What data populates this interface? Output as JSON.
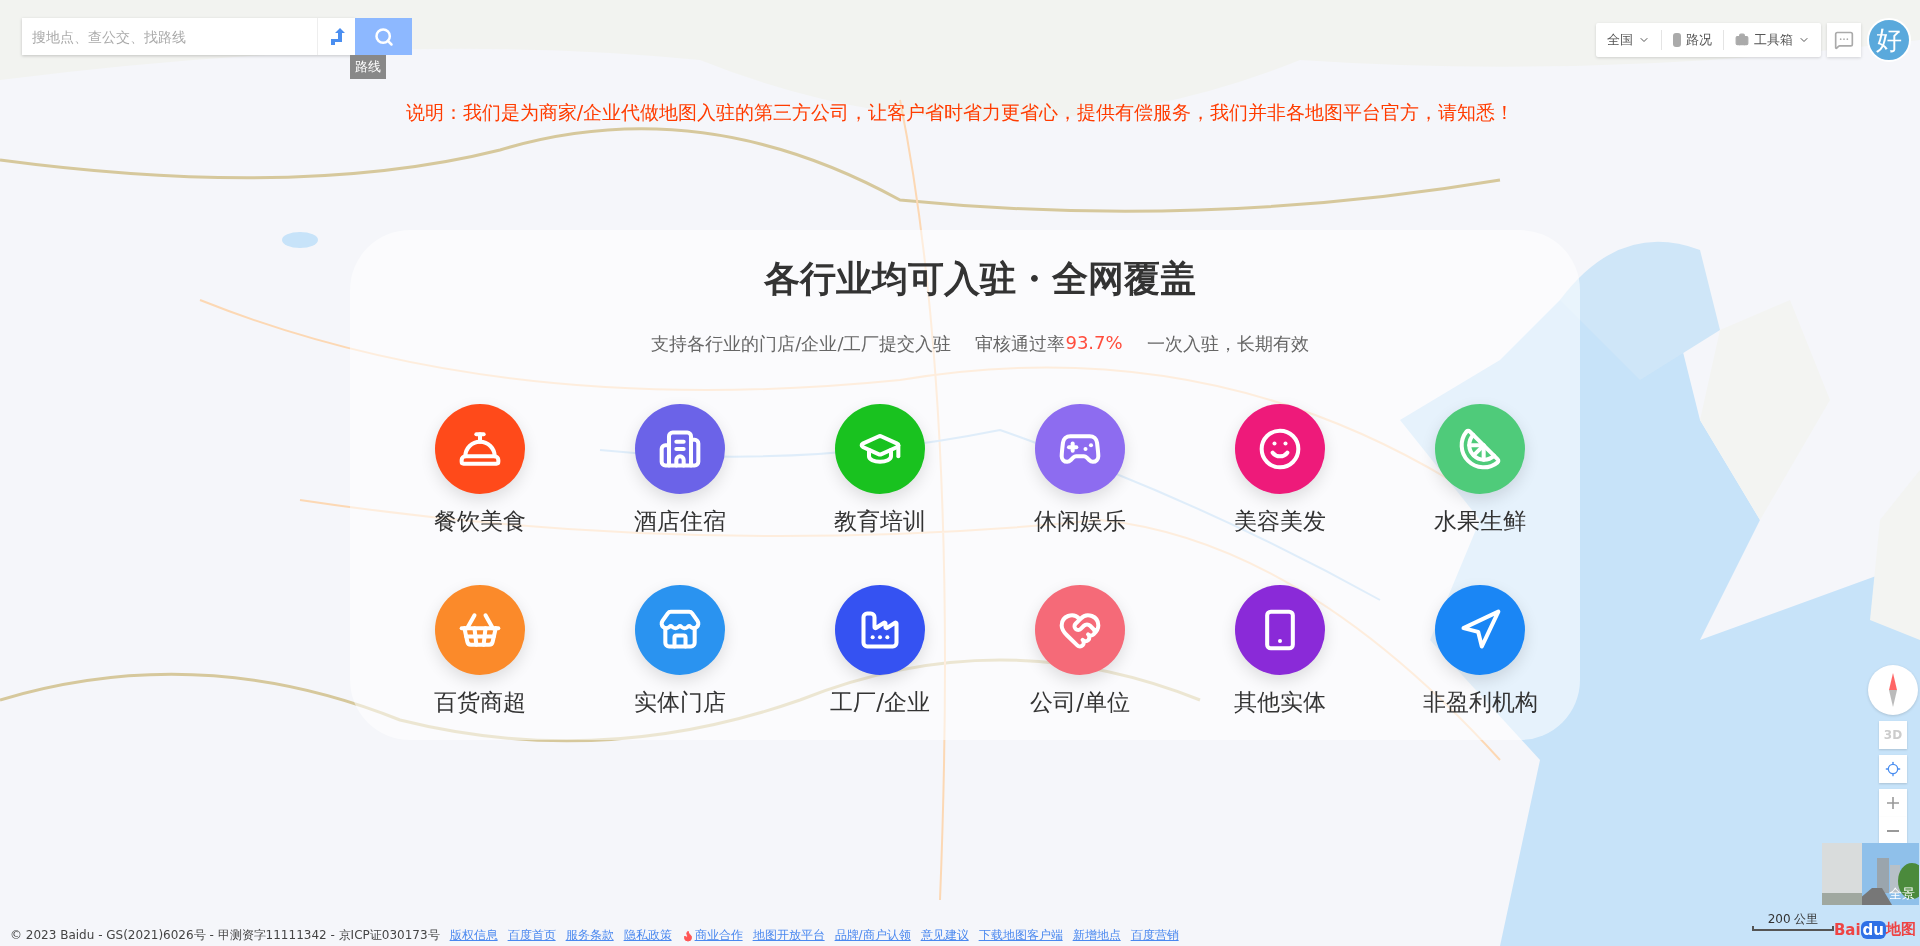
{
  "search": {
    "placeholder": "搜地点、查公交、找路线",
    "route_tooltip": "路线"
  },
  "toolbar": {
    "city": "全国",
    "traffic": "路况",
    "toolbox": "工具箱",
    "avatar": "好"
  },
  "notice": "说明：我们是为商家/企业代做地图入驻的第三方公司，让客户省时省力更省心，提供有偿服务，我们并非各地图平台官方，请知悉！",
  "panel": {
    "title": "各行业均可入驻・全网覆盖",
    "subtitle_parts": [
      {
        "text": "支持各行业的门店/企业/工厂提交入驻",
        "highlight": false
      },
      {
        "text": "审核通过率",
        "highlight": false
      },
      {
        "text": "93.7%",
        "highlight": true
      },
      {
        "text": "一次入驻，长期有效",
        "highlight": false
      }
    ],
    "categories": [
      {
        "label": "餐饮美食",
        "kind": "cloche",
        "color": "#ff4a1a"
      },
      {
        "label": "酒店住宿",
        "kind": "building",
        "color": "#6b63e8"
      },
      {
        "label": "教育培训",
        "kind": "cap",
        "color": "#19c21f"
      },
      {
        "label": "休闲娱乐",
        "kind": "game",
        "color": "#8d6cf0"
      },
      {
        "label": "美容美发",
        "kind": "face",
        "color": "#ee1a7a"
      },
      {
        "label": "水果生鲜",
        "kind": "fruit",
        "color": "#4fcb7a"
      },
      {
        "label": "百货商超",
        "kind": "basket",
        "color": "#fb8a2a"
      },
      {
        "label": "实体门店",
        "kind": "store",
        "color": "#2a93f0"
      },
      {
        "label": "工厂/企业",
        "kind": "factory",
        "color": "#3552f2"
      },
      {
        "label": "公司/单位",
        "kind": "heart",
        "color": "#f56a78"
      },
      {
        "label": "其他实体",
        "kind": "phone",
        "color": "#8a2ad8"
      },
      {
        "label": "非盈利机构",
        "kind": "nav",
        "color": "#1a86f5"
      }
    ]
  },
  "map_controls": {
    "three_d": "3D",
    "street_view": "全景",
    "scale": "200 公里",
    "logo": [
      "Bai",
      "du",
      "地图"
    ]
  },
  "footer": {
    "copyright": "© 2023 Baidu - GS(2021)6026号 - 甲测资字11111342 - 京ICP证030173号",
    "links": [
      {
        "text": "版权信息",
        "kind": "plain"
      },
      {
        "text": "百度首页",
        "kind": "plain"
      },
      {
        "text": "服务条款",
        "kind": "plain"
      },
      {
        "text": "隐私政策",
        "kind": "plain"
      },
      {
        "text": "商业合作",
        "kind": "hot"
      },
      {
        "text": "地图开放平台",
        "kind": "plain"
      },
      {
        "text": "品牌/商户认领",
        "kind": "plain"
      },
      {
        "text": "意见建议",
        "kind": "plain"
      },
      {
        "text": "下载地图客户端",
        "kind": "plain"
      },
      {
        "text": "新增地点",
        "kind": "plain"
      },
      {
        "text": "百度营销",
        "kind": "plain"
      }
    ]
  }
}
